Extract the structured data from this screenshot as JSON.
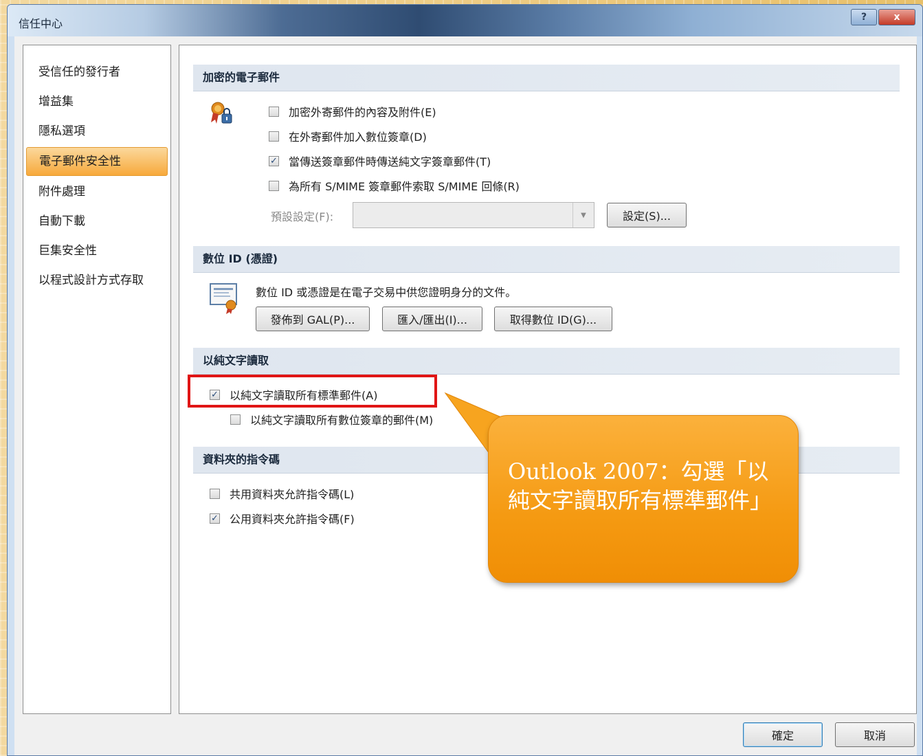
{
  "window": {
    "title": "信任中心",
    "help_label": "?",
    "close_label": "x"
  },
  "sidebar": {
    "items": [
      {
        "label": "受信任的發行者",
        "active": false
      },
      {
        "label": "增益集",
        "active": false
      },
      {
        "label": "隱私選項",
        "active": false
      },
      {
        "label": "電子郵件安全性",
        "active": true
      },
      {
        "label": "附件處理",
        "active": false
      },
      {
        "label": "自動下載",
        "active": false
      },
      {
        "label": "巨集安全性",
        "active": false
      },
      {
        "label": "以程式設計方式存取",
        "active": false
      }
    ]
  },
  "encrypted_mail": {
    "header": "加密的電子郵件",
    "options": [
      {
        "label": "加密外寄郵件的內容及附件(E)",
        "checked": false
      },
      {
        "label": "在外寄郵件加入數位簽章(D)",
        "checked": false
      },
      {
        "label": "當傳送簽章郵件時傳送純文字簽章郵件(T)",
        "checked": true
      },
      {
        "label": "為所有 S/MIME 簽章郵件索取 S/MIME 回條(R)",
        "checked": false
      }
    ],
    "default_setting_label": "預設設定(F):",
    "default_setting_value": "",
    "settings_button": "設定(S)..."
  },
  "digital_id": {
    "header": "數位 ID (憑證)",
    "description": "數位 ID 或憑證是在電子交易中供您證明身分的文件。",
    "buttons": [
      "發佈到 GAL(P)...",
      "匯入/匯出(I)...",
      "取得數位 ID(G)..."
    ]
  },
  "plain_text": {
    "header": "以純文字讀取",
    "options": [
      {
        "label": "以純文字讀取所有標準郵件(A)",
        "checked": true
      },
      {
        "label": "以純文字讀取所有數位簽章的郵件(M)",
        "checked": false
      }
    ]
  },
  "folder_script": {
    "header": "資料夾的指令碼",
    "options": [
      {
        "label": "共用資料夾允許指令碼(L)",
        "checked": false
      },
      {
        "label": "公用資料夾允許指令碼(F)",
        "checked": true
      }
    ]
  },
  "callout": {
    "text": "Outlook 2007：勾選「以純文字讀取所有標準郵件」"
  },
  "footer": {
    "ok": "確定",
    "cancel": "取消"
  },
  "check_mark": "✓",
  "icons": {
    "encryption": "certificate-lock-icon",
    "digital_id": "certificate-document-icon",
    "dropdown": "chevron-down-icon"
  }
}
